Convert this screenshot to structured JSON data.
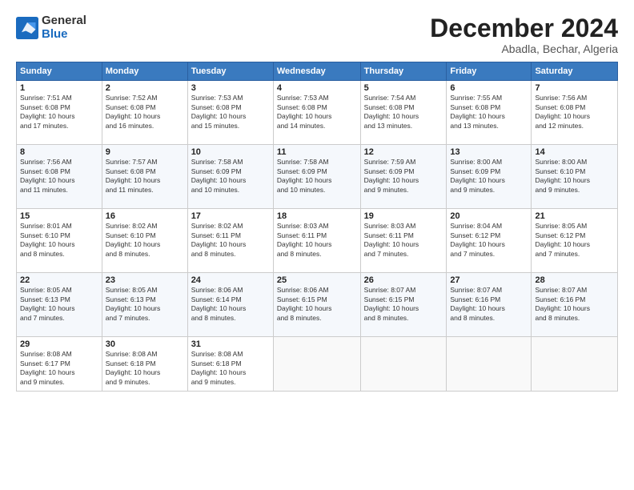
{
  "logo": {
    "general": "General",
    "blue": "Blue"
  },
  "title": "December 2024",
  "subtitle": "Abadla, Bechar, Algeria",
  "headers": [
    "Sunday",
    "Monday",
    "Tuesday",
    "Wednesday",
    "Thursday",
    "Friday",
    "Saturday"
  ],
  "weeks": [
    [
      {
        "day": "1",
        "info": "Sunrise: 7:51 AM\nSunset: 6:08 PM\nDaylight: 10 hours\nand 17 minutes."
      },
      {
        "day": "2",
        "info": "Sunrise: 7:52 AM\nSunset: 6:08 PM\nDaylight: 10 hours\nand 16 minutes."
      },
      {
        "day": "3",
        "info": "Sunrise: 7:53 AM\nSunset: 6:08 PM\nDaylight: 10 hours\nand 15 minutes."
      },
      {
        "day": "4",
        "info": "Sunrise: 7:53 AM\nSunset: 6:08 PM\nDaylight: 10 hours\nand 14 minutes."
      },
      {
        "day": "5",
        "info": "Sunrise: 7:54 AM\nSunset: 6:08 PM\nDaylight: 10 hours\nand 13 minutes."
      },
      {
        "day": "6",
        "info": "Sunrise: 7:55 AM\nSunset: 6:08 PM\nDaylight: 10 hours\nand 13 minutes."
      },
      {
        "day": "7",
        "info": "Sunrise: 7:56 AM\nSunset: 6:08 PM\nDaylight: 10 hours\nand 12 minutes."
      }
    ],
    [
      {
        "day": "8",
        "info": "Sunrise: 7:56 AM\nSunset: 6:08 PM\nDaylight: 10 hours\nand 11 minutes."
      },
      {
        "day": "9",
        "info": "Sunrise: 7:57 AM\nSunset: 6:08 PM\nDaylight: 10 hours\nand 11 minutes."
      },
      {
        "day": "10",
        "info": "Sunrise: 7:58 AM\nSunset: 6:09 PM\nDaylight: 10 hours\nand 10 minutes."
      },
      {
        "day": "11",
        "info": "Sunrise: 7:58 AM\nSunset: 6:09 PM\nDaylight: 10 hours\nand 10 minutes."
      },
      {
        "day": "12",
        "info": "Sunrise: 7:59 AM\nSunset: 6:09 PM\nDaylight: 10 hours\nand 9 minutes."
      },
      {
        "day": "13",
        "info": "Sunrise: 8:00 AM\nSunset: 6:09 PM\nDaylight: 10 hours\nand 9 minutes."
      },
      {
        "day": "14",
        "info": "Sunrise: 8:00 AM\nSunset: 6:10 PM\nDaylight: 10 hours\nand 9 minutes."
      }
    ],
    [
      {
        "day": "15",
        "info": "Sunrise: 8:01 AM\nSunset: 6:10 PM\nDaylight: 10 hours\nand 8 minutes."
      },
      {
        "day": "16",
        "info": "Sunrise: 8:02 AM\nSunset: 6:10 PM\nDaylight: 10 hours\nand 8 minutes."
      },
      {
        "day": "17",
        "info": "Sunrise: 8:02 AM\nSunset: 6:11 PM\nDaylight: 10 hours\nand 8 minutes."
      },
      {
        "day": "18",
        "info": "Sunrise: 8:03 AM\nSunset: 6:11 PM\nDaylight: 10 hours\nand 8 minutes."
      },
      {
        "day": "19",
        "info": "Sunrise: 8:03 AM\nSunset: 6:11 PM\nDaylight: 10 hours\nand 7 minutes."
      },
      {
        "day": "20",
        "info": "Sunrise: 8:04 AM\nSunset: 6:12 PM\nDaylight: 10 hours\nand 7 minutes."
      },
      {
        "day": "21",
        "info": "Sunrise: 8:05 AM\nSunset: 6:12 PM\nDaylight: 10 hours\nand 7 minutes."
      }
    ],
    [
      {
        "day": "22",
        "info": "Sunrise: 8:05 AM\nSunset: 6:13 PM\nDaylight: 10 hours\nand 7 minutes."
      },
      {
        "day": "23",
        "info": "Sunrise: 8:05 AM\nSunset: 6:13 PM\nDaylight: 10 hours\nand 7 minutes."
      },
      {
        "day": "24",
        "info": "Sunrise: 8:06 AM\nSunset: 6:14 PM\nDaylight: 10 hours\nand 8 minutes."
      },
      {
        "day": "25",
        "info": "Sunrise: 8:06 AM\nSunset: 6:15 PM\nDaylight: 10 hours\nand 8 minutes."
      },
      {
        "day": "26",
        "info": "Sunrise: 8:07 AM\nSunset: 6:15 PM\nDaylight: 10 hours\nand 8 minutes."
      },
      {
        "day": "27",
        "info": "Sunrise: 8:07 AM\nSunset: 6:16 PM\nDaylight: 10 hours\nand 8 minutes."
      },
      {
        "day": "28",
        "info": "Sunrise: 8:07 AM\nSunset: 6:16 PM\nDaylight: 10 hours\nand 8 minutes."
      }
    ],
    [
      {
        "day": "29",
        "info": "Sunrise: 8:08 AM\nSunset: 6:17 PM\nDaylight: 10 hours\nand 9 minutes."
      },
      {
        "day": "30",
        "info": "Sunrise: 8:08 AM\nSunset: 6:18 PM\nDaylight: 10 hours\nand 9 minutes."
      },
      {
        "day": "31",
        "info": "Sunrise: 8:08 AM\nSunset: 6:18 PM\nDaylight: 10 hours\nand 9 minutes."
      },
      null,
      null,
      null,
      null
    ]
  ]
}
